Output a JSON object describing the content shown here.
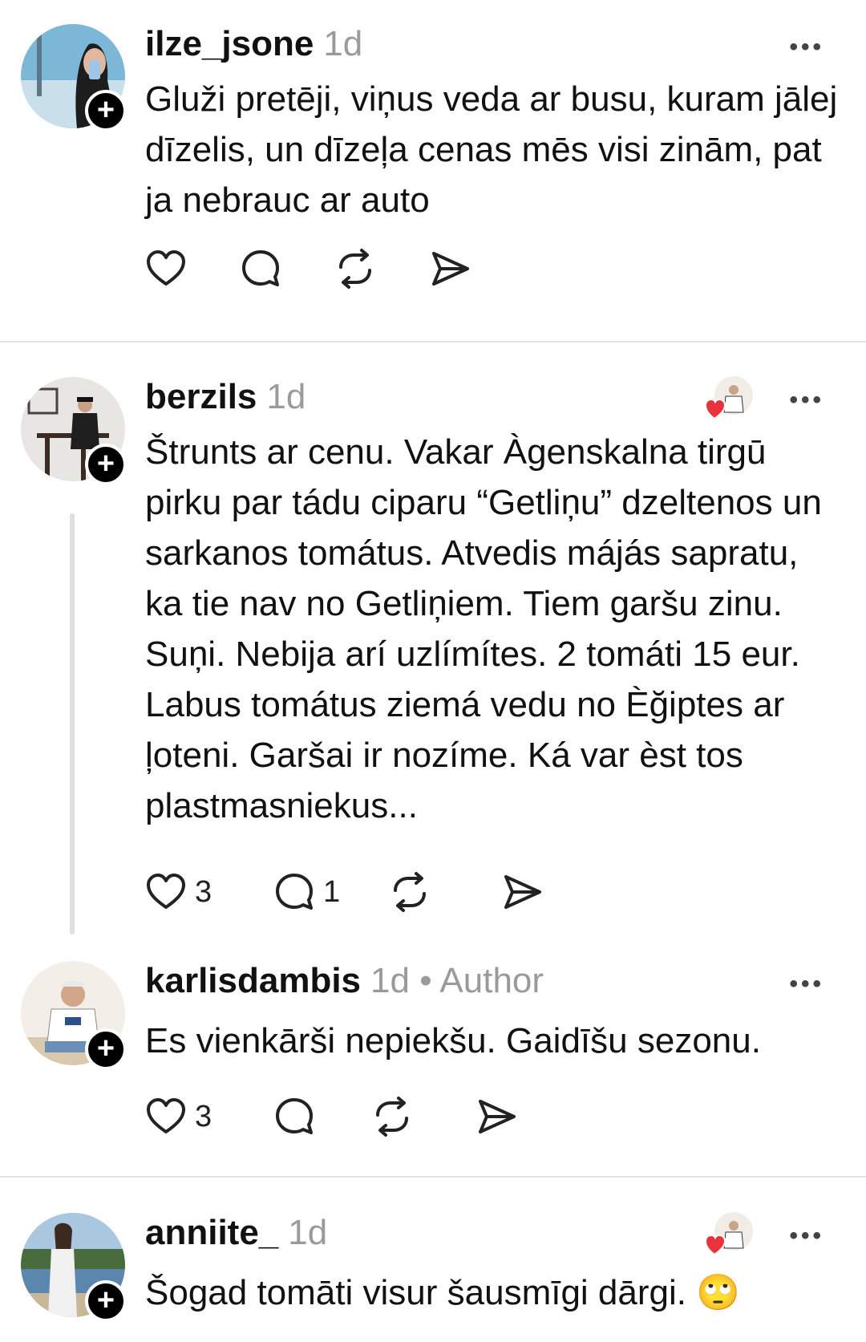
{
  "posts": [
    {
      "username": "ilze_jsone",
      "age": "1d",
      "author_tag": "",
      "text": "Gluži pretēji, viņus veda ar busu, kuram jālej dīzelis, un dīzeļa cenas mēs visi zinām, pat ja nebrauc ar auto",
      "like_count": "",
      "reply_count": "",
      "follow_symbol": "+",
      "more_symbol": "•••"
    },
    {
      "username": "berzils",
      "age": "1d",
      "author_tag": "",
      "text": "Štrunts ar cenu. Vakar Àgenskalna tirgū pirku par tádu ciparu “Getliņu” dzeltenos un sarkanos tomátus. Atvedis májás sapratu, ka tie nav no Getliņiem. Tiem garšu zinu. Suņi. Nebija arí uzlímítes. 2 tomáti 15 eur. Labus tomátus ziemá vedu no Èğiptes ar ļoteni. Garšai ir nozíme. Ká var èst tos plastmasniekus...",
      "like_count": "3",
      "reply_count": "1",
      "follow_symbol": "+",
      "more_symbol": "•••"
    },
    {
      "username": "karlisdambis",
      "age": "1d",
      "author_tag": "• Author",
      "text": "Es vienkārši nepiekšu. Gaidīšu sezonu.",
      "like_count": "3",
      "reply_count": "",
      "follow_symbol": "+",
      "more_symbol": "•••"
    },
    {
      "username": "anniite_",
      "age": "1d",
      "author_tag": "",
      "text": "Šogad tomāti visur šausmīgi dārgi. 🙄",
      "like_count": "",
      "reply_count": "",
      "follow_symbol": "+",
      "more_symbol": "•••"
    }
  ],
  "icons": {
    "like": "heart-icon",
    "reply": "comment-icon",
    "repost": "repost-icon",
    "share": "send-icon",
    "liked_by_author": "heart-badge-icon"
  },
  "colors": {
    "background": "#ffffff",
    "text": "#111111",
    "muted": "#9a9a9a",
    "heart_badge": "#e8323c",
    "divider": "#e4e4e4"
  }
}
